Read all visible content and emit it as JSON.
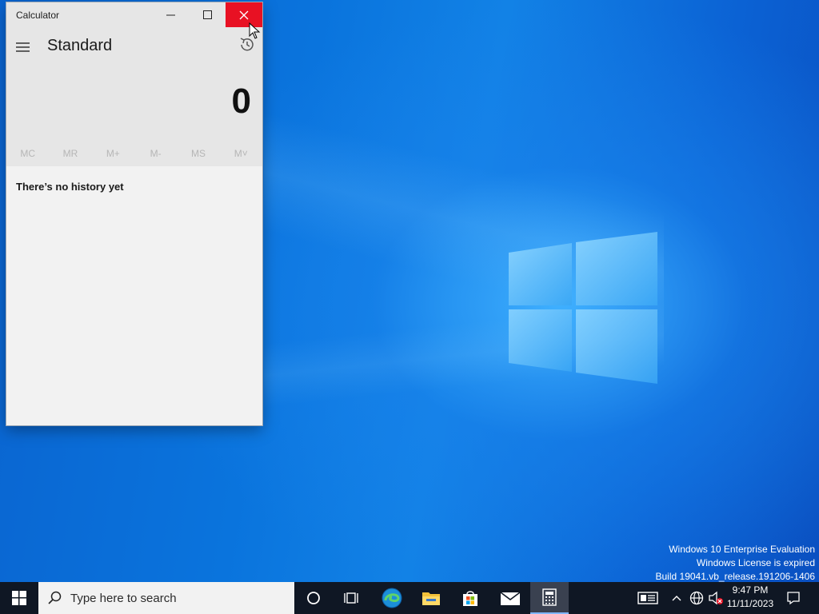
{
  "window": {
    "title": "Calculator",
    "mode": "Standard",
    "display_value": "0",
    "memory_buttons": [
      "MC",
      "MR",
      "M+",
      "M-",
      "MS",
      "M˅"
    ],
    "history_empty_text": "There’s no history yet"
  },
  "watermark": {
    "line1": "Windows 10 Enterprise Evaluation",
    "line2": "Windows License is expired",
    "line3": "Build 19041.vb_release.191206-1406"
  },
  "taskbar": {
    "search_placeholder": "Type here to search",
    "time": "9:47 PM",
    "date": "11/11/2023",
    "pinned_icons": [
      "windows-start-icon",
      "cortana-icon",
      "task-view-icon",
      "edge-icon",
      "file-explorer-icon",
      "store-icon",
      "mail-icon",
      "calculator-icon"
    ],
    "tray_icons": [
      "news-icon",
      "chevron-up-icon",
      "network-icon",
      "volume-muted-icon",
      "notification-icon"
    ]
  },
  "colors": {
    "close_button": "#e81123",
    "taskbar": "#0f1724",
    "desktop": "#0a74dd"
  }
}
